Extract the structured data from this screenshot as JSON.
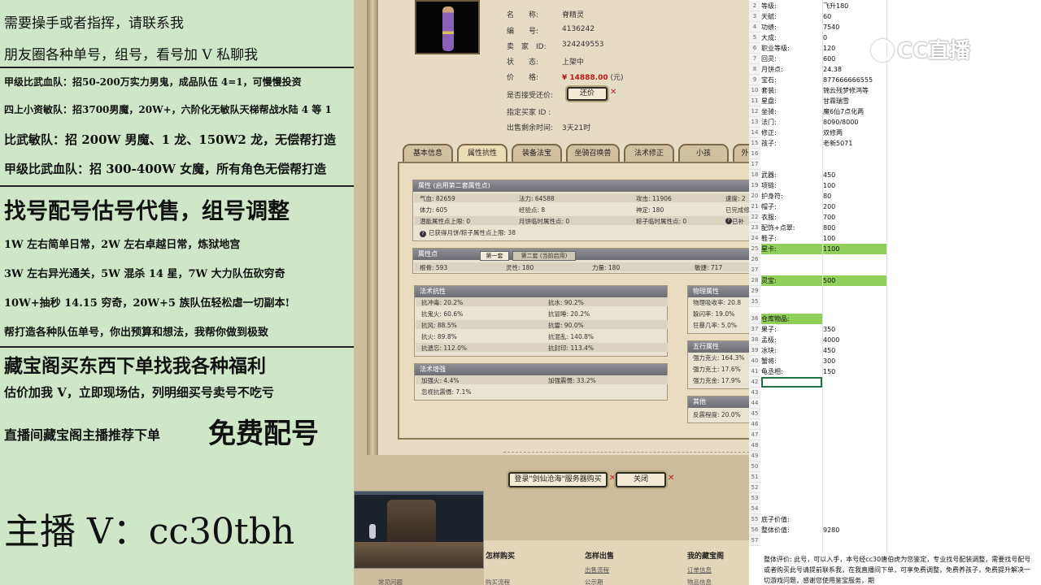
{
  "left_ad": {
    "l1": "需要操手或者指挥，请联系我",
    "l2": "朋友圈各种单号，组号，看号加 V 私聊我",
    "l3": "甲级比武血队：招50-200万实力男鬼，成品队伍 4=1，可慢慢投资",
    "l4": "四上小资敏队：招3700男魔，20W+，六阶化无敏队天梯帮战水陆 4 等 1",
    "l5": "比武敏队：招 200W 男魔、1 龙、150W2 龙，无偿帮打造",
    "l6": "甲级比武血队：招 300-400W 女魔，所有角色无偿帮打造",
    "l7": "找号配号估号代售，组号调整",
    "l8": "1W 左右简单日常，2W 左右卓越日常，炼狱地宫",
    "l9": "3W 左右异光通关，5W 混杀 14 星，7W 大力队伍砍穷奇",
    "l10": "10W+抽秒 14.15 穷奇，20W+5 族队伍轻松虐一切副本!",
    "l11": "帮打造各种队伍单号，你出预算和想法，我帮你做到极致",
    "l12": "藏宝阁买东西下单找我各种福利",
    "l13": "估价加我 V，立即现场估，列明细买号卖号不吃亏",
    "l14a": "直播间藏宝阁主播推荐下单",
    "l14b": "免费配号",
    "l15": "主播 V：cc30tbh"
  },
  "game": {
    "info": {
      "name_k": "名　　称:",
      "name_v": "脊精灵",
      "id_k": "编　　号:",
      "id_v": "4136242",
      "seller_k": "卖　家　ID:",
      "seller_v": "324249553",
      "status_k": "状　　态:",
      "status_v": "上架中",
      "price_k": "价　　格:",
      "price_v": "¥ 14888.00",
      "price_unit": "(元)",
      "bargain_k": "是否接受还价:",
      "buyer_k": "指定买家 ID :",
      "remain_k": "出售剩余时间:",
      "remain_v": "3天21时",
      "bargain_btn": "还价"
    },
    "tabs": [
      "基本信息",
      "属性抗性",
      "装备法宝",
      "坐骑召唤兽",
      "法术修正",
      "小孩",
      "外"
    ],
    "attr": {
      "header": "属性 (启用第二套属性点)",
      "r1": [
        "气血: 82659",
        "法力: 64588",
        "攻击: 11906",
        "速度: 2"
      ],
      "r2": [
        "体力: 605",
        "经验点: 8",
        "神定: 180",
        "已完成修"
      ],
      "r3": [
        "潜能属性点上限: 0",
        "月饼临时属性点: 0",
        "粽子临时属性点: 0",
        "已补"
      ],
      "r4": "已获得月饼/粽子属性点上限: 38"
    },
    "points": {
      "header": "属性点",
      "tab1": "第一套",
      "tab2": "第二套 (当前启用)",
      "vals": [
        "根骨: 593",
        "灵性: 180",
        "力量: 180",
        "敏捷: 717"
      ]
    },
    "resist": {
      "header": "法术抗性",
      "rows": [
        [
          "抗冲毒: 20.2%",
          "抗水: 90.2%"
        ],
        [
          "抗鬼火: 60.6%",
          "抗冒睡: 20.2%"
        ],
        [
          "抗风: 88.5%",
          "抗雷: 90.0%"
        ],
        [
          "抗火: 89.8%",
          "抗混乱: 140.8%"
        ],
        [
          "抗遗忘: 112.0%",
          "抗封印: 113.4%"
        ]
      ]
    },
    "enhance": {
      "header": "法术增强",
      "rows": [
        [
          "加强火: 4.4%",
          "加强震慑: 33.2%"
        ],
        [
          "忽视抗震慑: 7.1%",
          ""
        ]
      ]
    },
    "phys": {
      "header": "物理属性",
      "rows": [
        "物理吸收率: 20.8",
        "躲闪率: 19.0%",
        "狂暴几率: 5.0%"
      ]
    },
    "wuxing": {
      "header": "五行属性",
      "rows": [
        "强力克火: 164.3%",
        "强力克土: 17.6%",
        "强力克金: 17.9%"
      ]
    },
    "other": {
      "header": "其他",
      "rows": [
        "反震程度: 20.0%"
      ]
    },
    "btn_buy": "登录\"剑仙沧海\"服务器购买",
    "btn_close": "关闭",
    "nav": {
      "h1": "怎样购买",
      "h2": "怎样出售",
      "h3": "我的藏宝阁",
      "l1": "常见问题",
      "l2": "购买流程",
      "l3": "出售流程",
      "l4": "公示期",
      "l5": "订单信息",
      "l6": "物品信息"
    }
  },
  "sheet": {
    "logo": "CC直播",
    "rows": [
      {
        "n": "2",
        "k": "等级:",
        "v": "飞升180"
      },
      {
        "n": "3",
        "k": "天赋:",
        "v": "60"
      },
      {
        "n": "4",
        "k": "功绩:",
        "v": "7540"
      },
      {
        "n": "5",
        "k": "大成:",
        "v": "0"
      },
      {
        "n": "6",
        "k": "职业等级:",
        "v": "120"
      },
      {
        "n": "7",
        "k": "回灵:",
        "v": "600"
      },
      {
        "n": "8",
        "k": "月饼点:",
        "v": "24.38"
      },
      {
        "n": "9",
        "k": "宝石:",
        "v": "877666666555"
      },
      {
        "n": "10",
        "k": "套装:",
        "v": "锦云残梦修鸿等"
      },
      {
        "n": "11",
        "k": "星盘:",
        "v": "甘霖瑞雪"
      },
      {
        "n": "12",
        "k": "坐骑:",
        "v": "魔6仙7点化两"
      },
      {
        "n": "13",
        "k": "法门:",
        "v": "8090/8000"
      },
      {
        "n": "14",
        "k": "修正:",
        "v": "双修两"
      },
      {
        "n": "15",
        "k": "孩子:",
        "v": "老新5071"
      },
      {
        "n": "16",
        "k": "",
        "v": ""
      },
      {
        "n": "17",
        "k": "",
        "v": ""
      },
      {
        "n": "18",
        "k": "武器:",
        "v": "450"
      },
      {
        "n": "19",
        "k": "项链:",
        "v": "100"
      },
      {
        "n": "20",
        "k": "护身符:",
        "v": "80"
      },
      {
        "n": "21",
        "k": "帽子:",
        "v": "200"
      },
      {
        "n": "22",
        "k": "衣服:",
        "v": "700"
      },
      {
        "n": "23",
        "k": "配饰+点翠:",
        "v": "800"
      },
      {
        "n": "24",
        "k": "鞋子:",
        "v": "100"
      },
      {
        "n": "25",
        "k": "星卡:",
        "v": "1100"
      },
      {
        "n": "26",
        "k": "",
        "v": ""
      },
      {
        "n": "27",
        "k": "",
        "v": ""
      },
      {
        "n": "28",
        "k": "灵宝:",
        "v": "500"
      },
      {
        "n": "29",
        "k": "",
        "v": ""
      },
      {
        "n": "35",
        "k": "",
        "v": ""
      },
      {
        "n": "36",
        "k": "仓库物品:",
        "v": ""
      },
      {
        "n": "37",
        "k": "果子:",
        "v": "350"
      },
      {
        "n": "38",
        "k": "孟极:",
        "v": "4000"
      },
      {
        "n": "39",
        "k": "冰块:",
        "v": "450"
      },
      {
        "n": "40",
        "k": "蟹将:",
        "v": "300"
      },
      {
        "n": "41",
        "k": "龟丞相:",
        "v": "150"
      },
      {
        "n": "42",
        "k": "",
        "v": ""
      },
      {
        "n": "43",
        "k": "",
        "v": ""
      },
      {
        "n": "44",
        "k": "",
        "v": ""
      },
      {
        "n": "45",
        "k": "",
        "v": ""
      },
      {
        "n": "46",
        "k": "",
        "v": ""
      },
      {
        "n": "47",
        "k": "",
        "v": ""
      },
      {
        "n": "48",
        "k": "",
        "v": ""
      },
      {
        "n": "49",
        "k": "",
        "v": ""
      },
      {
        "n": "50",
        "k": "",
        "v": ""
      },
      {
        "n": "51",
        "k": "",
        "v": ""
      },
      {
        "n": "52",
        "k": "",
        "v": ""
      },
      {
        "n": "53",
        "k": "",
        "v": ""
      },
      {
        "n": "54",
        "k": "",
        "v": ""
      },
      {
        "n": "55",
        "k": "底子价值:",
        "v": ""
      },
      {
        "n": "56",
        "k": "整体价值:",
        "v": "9280"
      },
      {
        "n": "57",
        "k": "",
        "v": ""
      }
    ],
    "note": "整体评价: 此号，可以入手，本号经cc30唐伯虎为您鉴定，专业找号配装调整，需要找号配号或者购买此号请提前联系我，在我直播间下单，可享免费调整，免费养孩子，免费提升解决一切游戏问题，感谢您使用鉴宝服务，期"
  }
}
